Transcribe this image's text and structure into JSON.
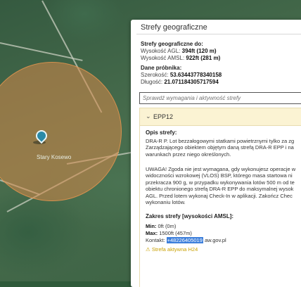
{
  "map": {
    "place_label": "Stary Kosewo"
  },
  "panel": {
    "title": "Strefy geograficzne",
    "heights": {
      "heading": "Strefy geograficzne do:",
      "agl_label": "Wysokość AGL:",
      "agl_value": "394ft (120 m)",
      "amsl_label": "Wysokość AMSL:",
      "amsl_value": "922ft (281 m)"
    },
    "probe": {
      "heading": "Dane próbnika:",
      "lat_label": "Szerokość:",
      "lat_value": "53.63443778340158",
      "lon_label": "Długość:",
      "lon_value": "21.071184305717594"
    },
    "search_placeholder": "Sprawdź wymagania i aktywność strefy",
    "zone": {
      "name": "EPP12",
      "opis_heading": "Opis strefy:",
      "paragraph1": [
        "DRA-R P. Lot bezzałogowymi statkami powietrznymi tylko za zg",
        "Zarządzającego obiektem objętym daną strefą DRA-R EPP i na",
        "warunkach przez niego określonych."
      ],
      "paragraph2": [
        "UWAGA! Zgoda nie jest wymagana, gdy wykonujesz operacje w",
        "widoczności wzrokowej (VLOS) BSP, którego masa startowa ni",
        "przekracza 900 g, w przypadku wykonywania lotów 500 m od te",
        "obiektu chronionego strefą DRA-R EPP do maksymalnej wysok",
        "AGL. Przed lotem wykonaj Check-In w aplikacji. Zakończ Chec",
        "wykonaniu lotów."
      ],
      "range_heading": "Zakres strefy [wysokości AMSL]:",
      "min_label": "Min:",
      "min_value": "0ft (0m)",
      "max_label": "Max:",
      "max_value": "1500ft (457m)",
      "contact_label": "Kontakt:",
      "contact_phone": "+48226405019",
      "contact_rest": "aw.gov.pl",
      "active_text": "Strefa aktywna H24"
    }
  }
}
